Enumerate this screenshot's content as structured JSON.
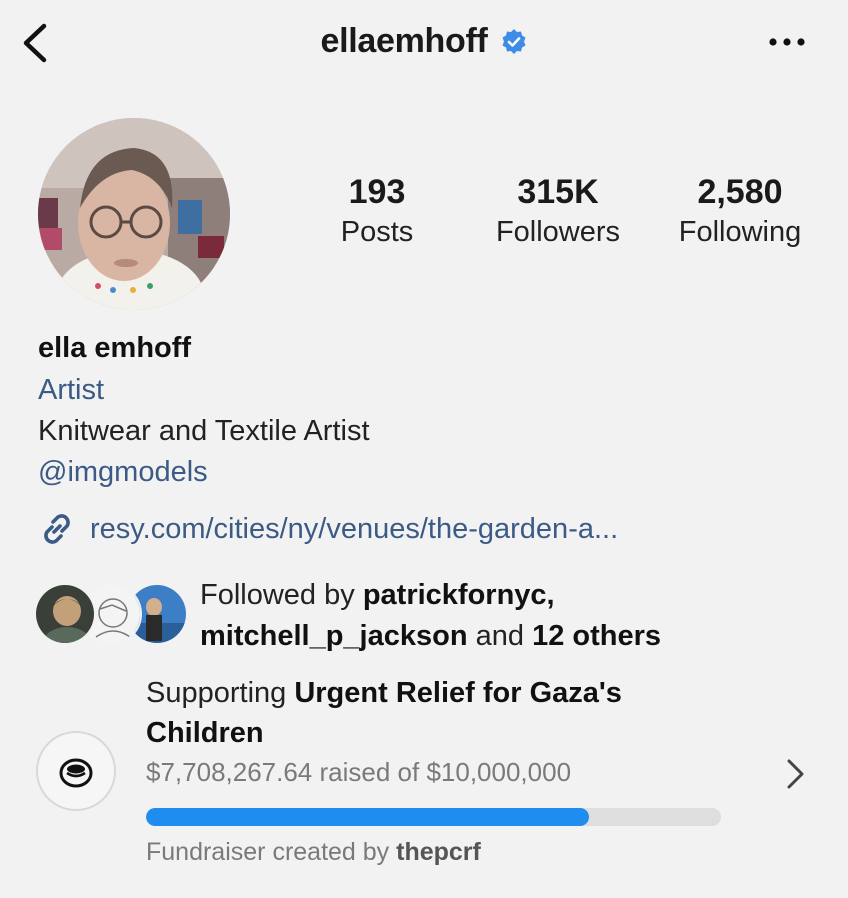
{
  "header": {
    "username": "ellaemhoff",
    "back_icon": "chevron-left-icon",
    "verified_icon": "verified-badge-icon",
    "more_icon": "more-horizontal-icon"
  },
  "stats": {
    "posts": {
      "value": "193",
      "label": "Posts"
    },
    "followers": {
      "value": "315K",
      "label": "Followers"
    },
    "following": {
      "value": "2,580",
      "label": "Following"
    }
  },
  "bio": {
    "name": "ella emhoff",
    "category": "Artist",
    "text": "Knitwear and Textile Artist",
    "mention": "@imgmodels",
    "link": "resy.com/cities/ny/venues/the-garden-a..."
  },
  "followed_by": {
    "prefix": "Followed by ",
    "user1": "patrickfornyc",
    "comma": ",",
    "user2": "mitchell_p_jackson",
    "and": " and ",
    "others": "12 others"
  },
  "fundraiser": {
    "supporting": "Supporting ",
    "cause_line1": "Urgent Relief for Gaza's",
    "cause_line2": "Children",
    "raised_text": "$7,708,267.64 raised of $10,000,000",
    "progress_fraction": 0.77,
    "creator_prefix": "Fundraiser created by ",
    "creator": "thepcrf",
    "icon": "donation-coin-icon"
  },
  "colors": {
    "link": "#3b5b86",
    "verified": "#3c8ce8",
    "progress": "#1f8cf0",
    "background": "#f2f2f2"
  }
}
